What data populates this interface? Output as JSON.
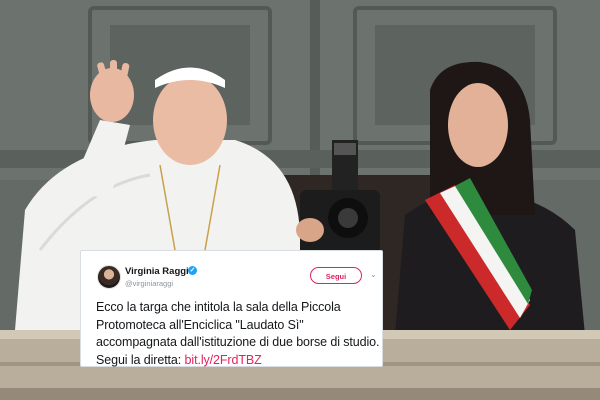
{
  "tweet": {
    "author_name": "Virginia Raggi",
    "author_handle": "@virginiaraggi",
    "follow_label": "Segui",
    "text": "Ecco la targa che intitola la sala della Piccola Protomoteca all'Enciclica \"Laudato Sì\" accompagnata dall'istituzione di due borse di studio. Segui la diretta: ",
    "link_text": "bit.ly/2FrdTBZ"
  },
  "colors": {
    "link": "#e0245e",
    "verified": "#1da1f2",
    "sash_green": "#2e8b3e",
    "sash_white": "#f4f4f2",
    "sash_red": "#cc2a2a"
  },
  "icons": [
    "verified-badge-icon",
    "chevron-down-icon"
  ]
}
